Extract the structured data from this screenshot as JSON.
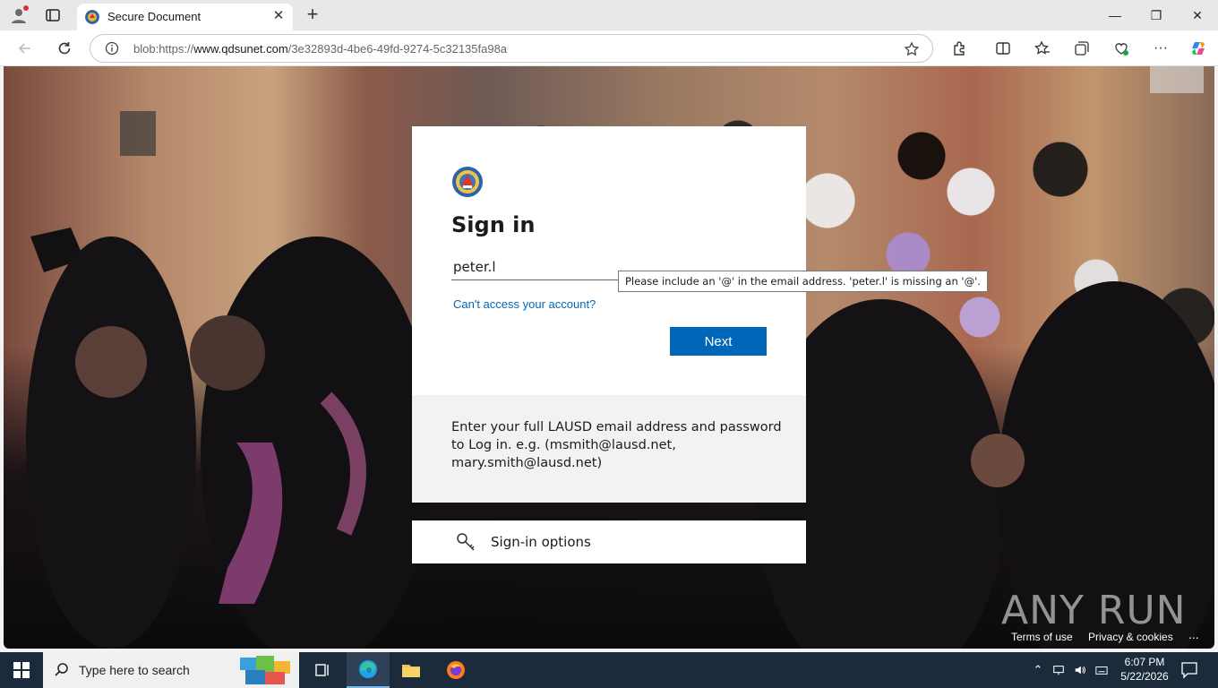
{
  "browser": {
    "tab_title": "Secure Document",
    "url_prefix": "blob:https://",
    "url_host": "www.qdsunet.com",
    "url_path": "/3e32893d-4be6-49fd-9274-5c32135fa98a"
  },
  "signin": {
    "heading": "Sign in",
    "email_value": "peter.l",
    "cant_access": "Can't access your account?",
    "next_label": "Next",
    "validation_tooltip": "Please include an '@' in the email address. 'peter.l' is missing an '@'.",
    "info_text": "Enter your full LAUSD email address and password to Log in. e.g. (msmith@lausd.net, mary.smith@lausd.net)",
    "options_label": "Sign-in options"
  },
  "footer": {
    "watermark": "ANY RUN",
    "terms": "Terms of use",
    "privacy": "Privacy & cookies",
    "more": "..."
  },
  "taskbar": {
    "search_placeholder": "Type here to search",
    "time": "6:07 PM",
    "date": "5/22/2026"
  },
  "colors": {
    "accent": "#0067b8",
    "taskbar": "#1c2b3c"
  }
}
